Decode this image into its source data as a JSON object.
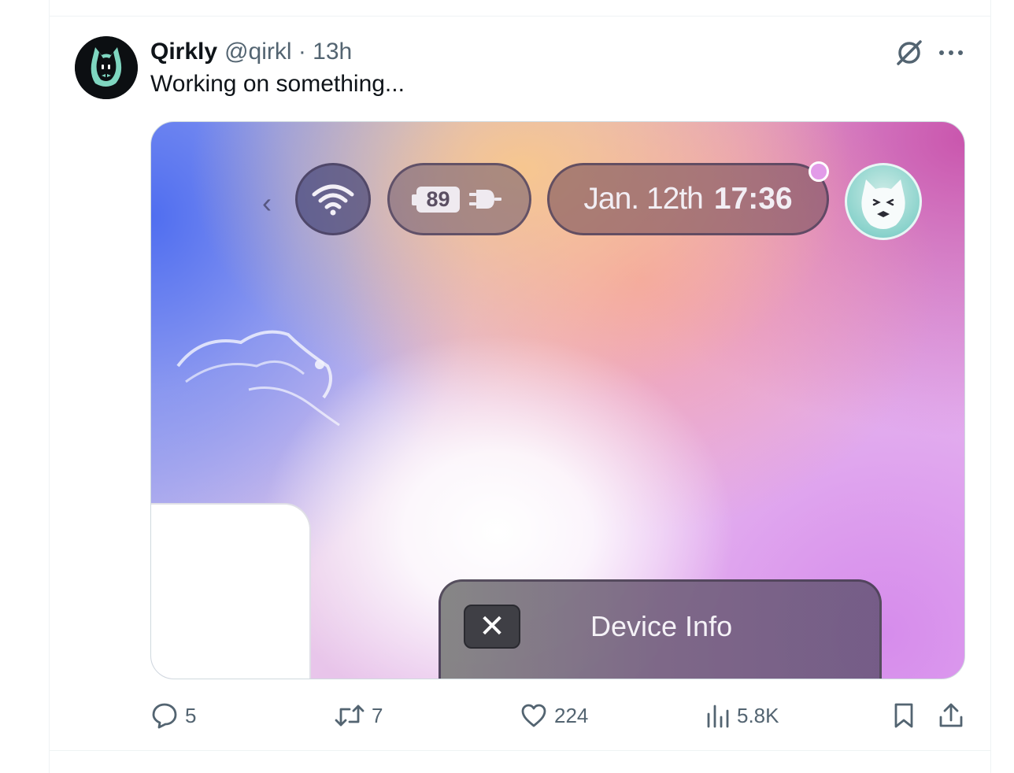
{
  "tweet": {
    "author_name": "Qirkly",
    "handle_time": "@qirkl · 13h",
    "text": "Working on something..."
  },
  "media": {
    "status_bar": {
      "battery_level": "89",
      "date": "Jan. 12th",
      "time": "17:36"
    },
    "panel": {
      "close_label": "✕",
      "title": "Device Info"
    }
  },
  "actions": {
    "replies": "5",
    "reposts": "7",
    "likes": "224",
    "views": "5.8K"
  },
  "icons": {
    "back": "chevron-left-icon",
    "wifi": "wifi-icon",
    "plug": "plug-icon",
    "grok": "grok-icon",
    "more": "more-icon",
    "reply": "reply-icon",
    "repost": "repost-icon",
    "like": "heart-icon",
    "views": "views-icon",
    "bookmark": "bookmark-icon",
    "share": "share-icon"
  },
  "colors": {
    "text_primary": "#0f1419",
    "text_secondary": "#536471",
    "border": "#eff3f4"
  }
}
